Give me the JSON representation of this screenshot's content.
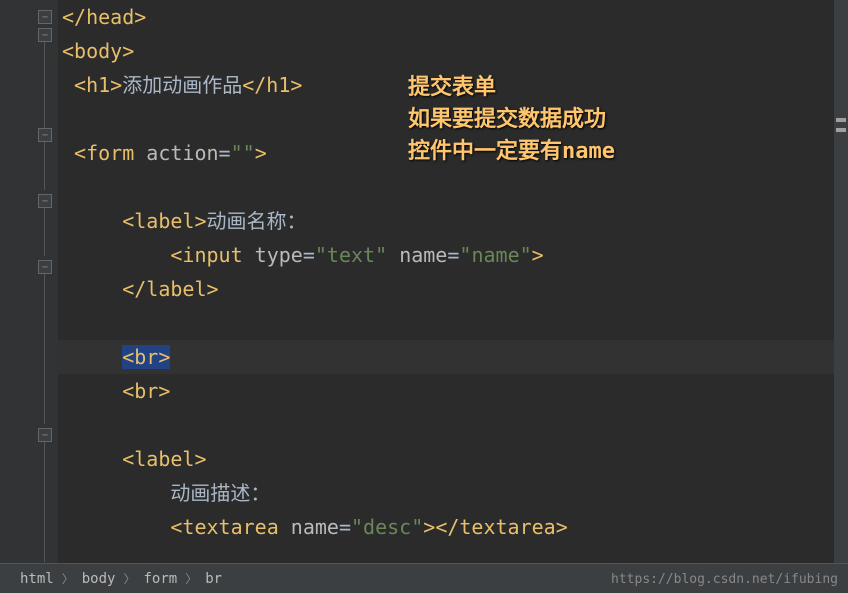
{
  "code": {
    "line1_close": "</",
    "line1_tag": "head",
    "line1_end": ">",
    "body_open": "<body>",
    "h1_open": "<h1>",
    "h1_text": "添加动画作品",
    "h1_close": "</h1>",
    "form_open1": "<form ",
    "form_attr": "action",
    "form_eq": "=",
    "form_val": "\"\"",
    "form_open2": ">",
    "label_open": "<label>",
    "label1_text": "动画名称：",
    "input_open": "<input ",
    "input_attr1": "type",
    "input_val1": "\"text\"",
    "input_attr2": "name",
    "input_val2": "\"name\"",
    "input_close": ">",
    "label_close": "</label>",
    "br": "<br>",
    "label2_text": "动画描述：",
    "textarea_open": "<textarea ",
    "textarea_attr": "name",
    "textarea_val": "\"desc\"",
    "textarea_mid": ">",
    "textarea_close": "</textarea>"
  },
  "annotation": {
    "line1": "提交表单",
    "line2": "如果要提交数据成功",
    "line3": "控件中一定要有name"
  },
  "breadcrumb": {
    "item1": "html",
    "item2": "body",
    "item3": "form",
    "item4": "br"
  },
  "watermark": "https://blog.csdn.net/ifubing"
}
